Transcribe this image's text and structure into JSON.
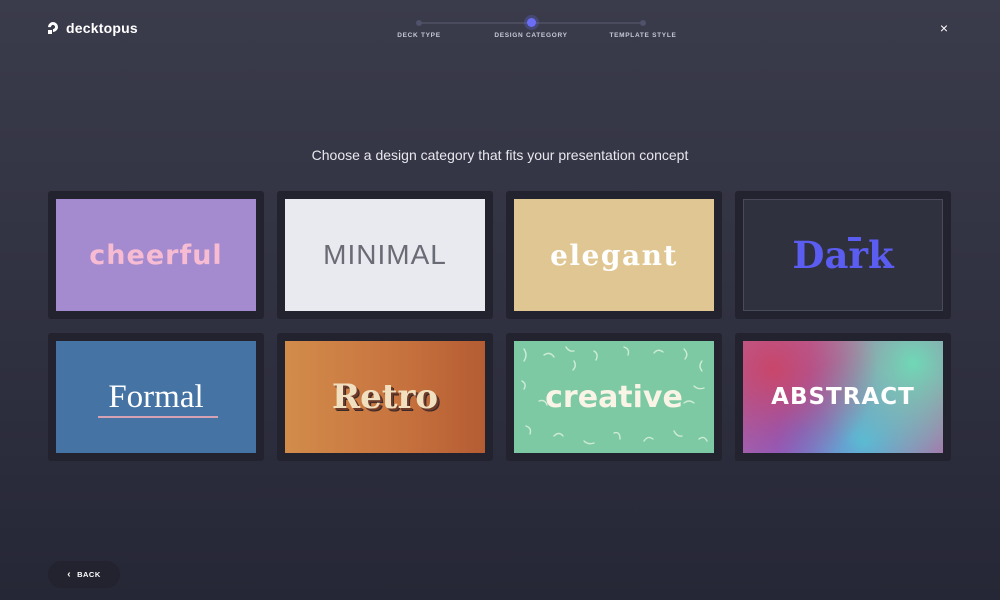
{
  "brand": {
    "name": "decktopus"
  },
  "stepper": {
    "steps": [
      {
        "label": "DECK TYPE"
      },
      {
        "label": "DESIGN CATEGORY"
      },
      {
        "label": "TEMPLATE STYLE"
      }
    ],
    "active_step": "DESIGN CATEGORY"
  },
  "close": {
    "icon": "close-icon",
    "glyph": "×"
  },
  "prompt": "Choose a design category that fits your presentation concept",
  "categories": [
    {
      "label": "cheerful"
    },
    {
      "label": "MINIMAL"
    },
    {
      "label": "elegant"
    },
    {
      "label": "Dark"
    },
    {
      "label": "Formal"
    },
    {
      "label": "Retro"
    },
    {
      "label": "creative"
    },
    {
      "label": "ABSTRACT"
    }
  ],
  "back_button": {
    "label": "BACK",
    "icon": "chevron-left-icon"
  },
  "colors": {
    "accent": "#6b6ef5",
    "background_top": "#3a3b4b",
    "background_bottom": "#262736",
    "card_frame": "#22232f"
  }
}
